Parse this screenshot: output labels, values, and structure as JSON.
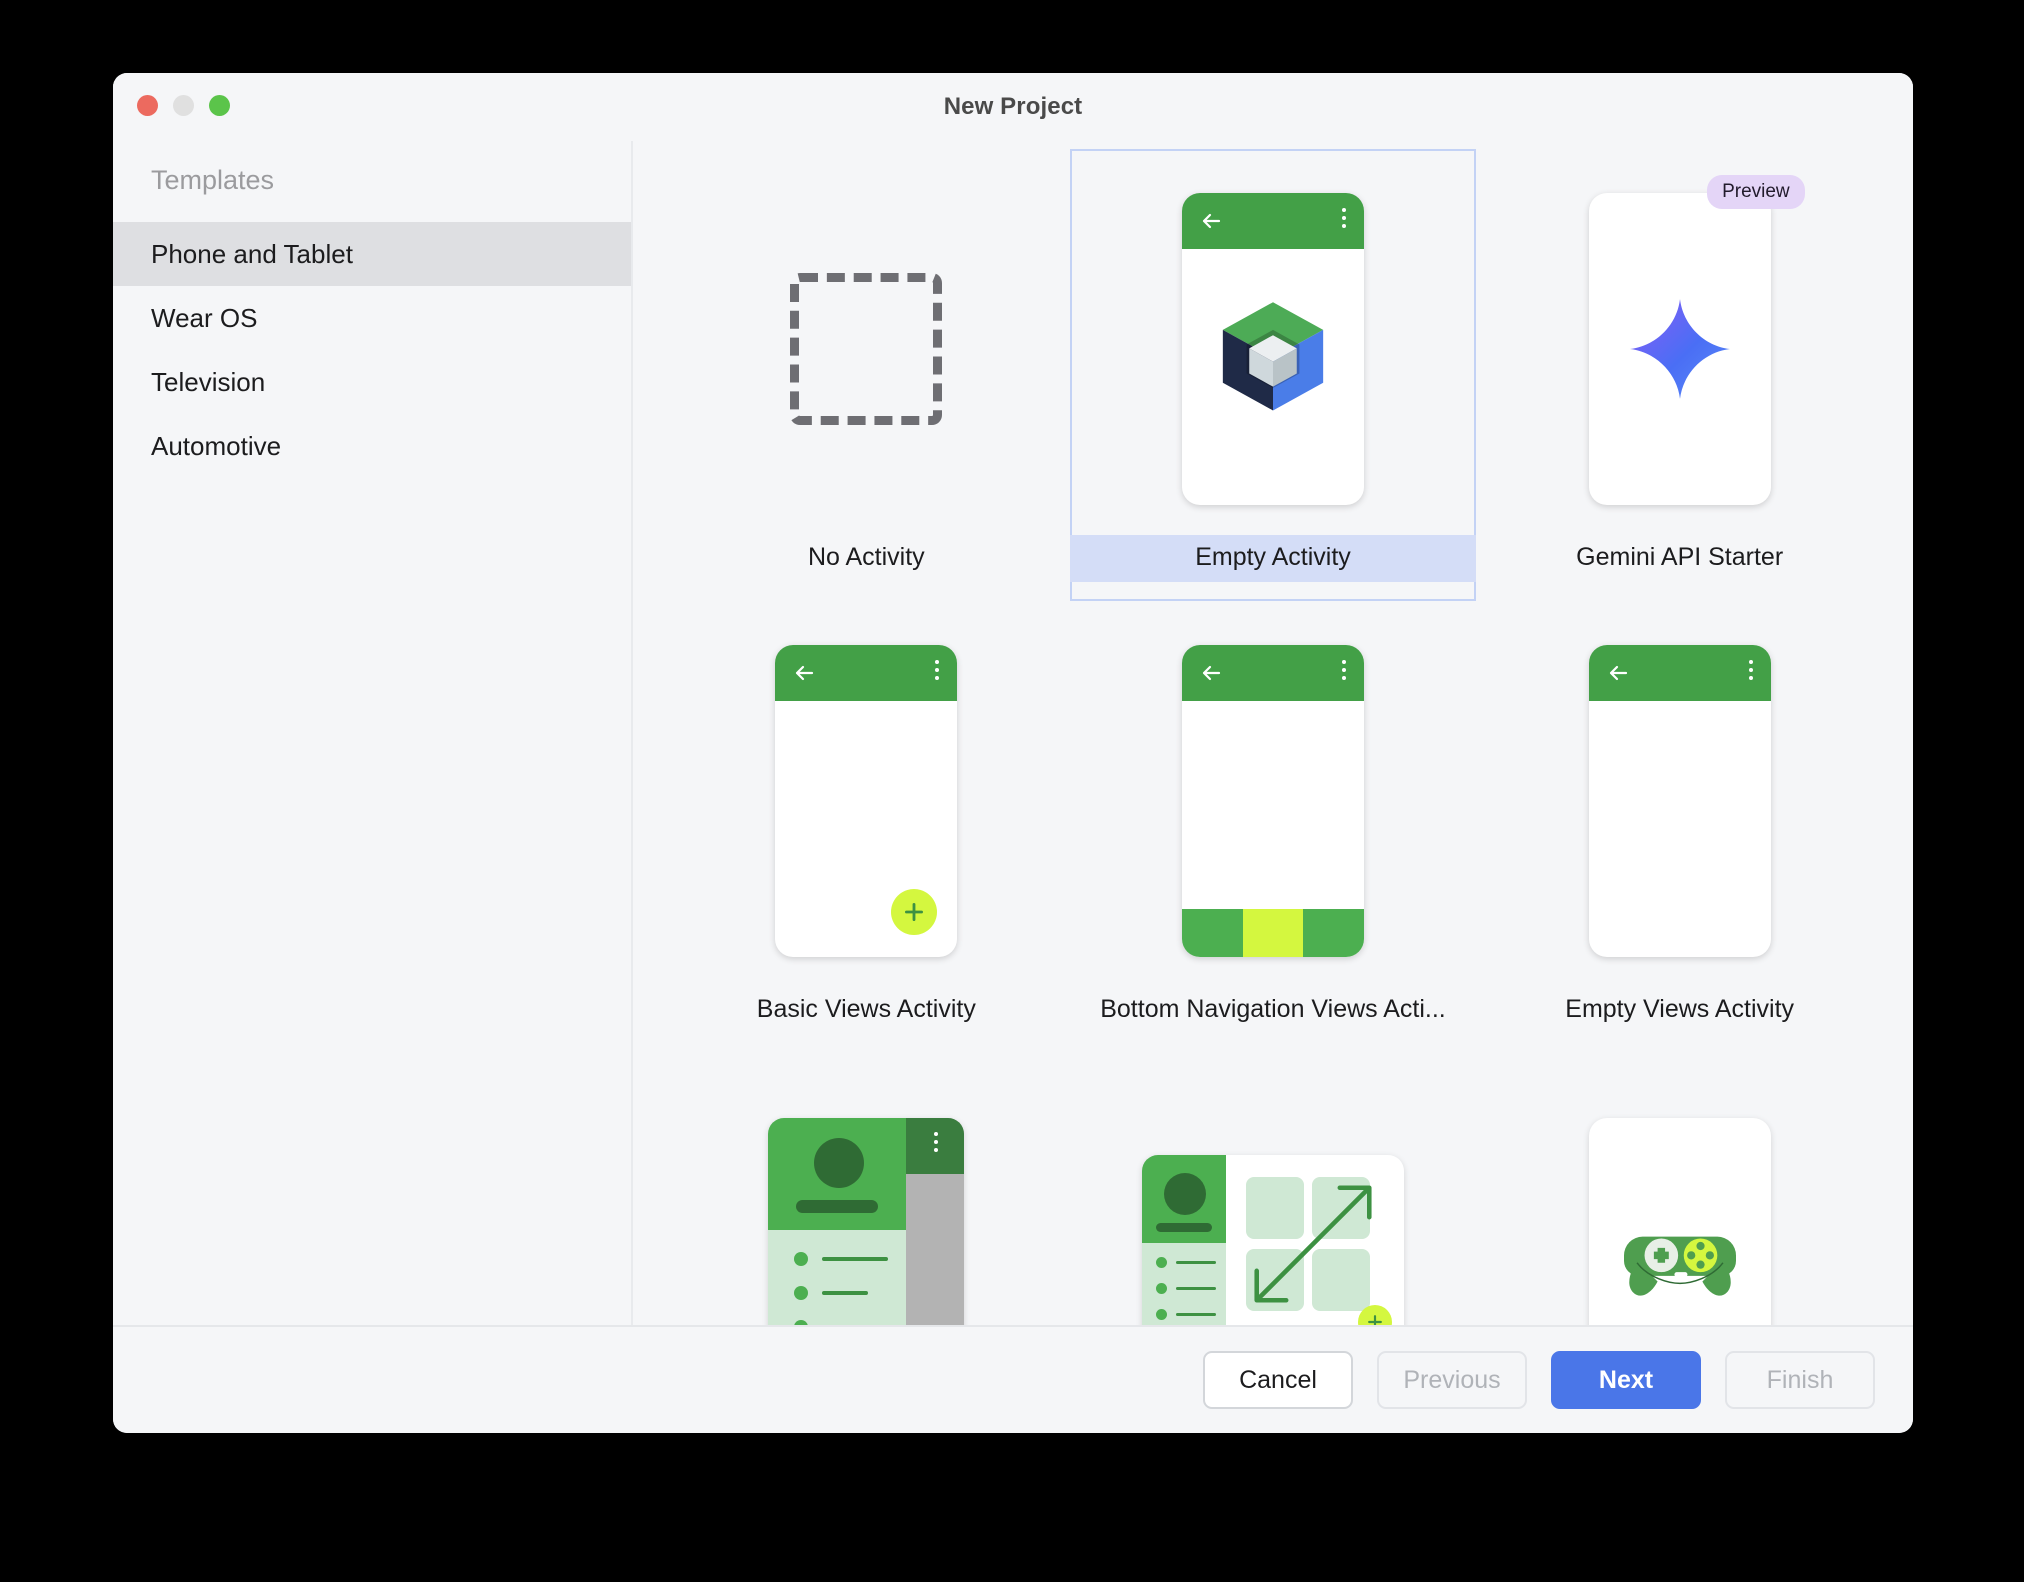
{
  "window": {
    "title": "New Project",
    "traffic_lights": [
      "close-button",
      "minimize-button",
      "maximize-button"
    ]
  },
  "sidebar": {
    "heading": "Templates",
    "items": [
      {
        "label": "Phone and Tablet",
        "selected": true
      },
      {
        "label": "Wear OS",
        "selected": false
      },
      {
        "label": "Television",
        "selected": false
      },
      {
        "label": "Automotive",
        "selected": false
      }
    ]
  },
  "templates": [
    {
      "label": "No Activity",
      "selected": false,
      "badge": null
    },
    {
      "label": "Empty Activity",
      "selected": true,
      "badge": null
    },
    {
      "label": "Gemini API Starter",
      "selected": false,
      "badge": "Preview"
    },
    {
      "label": "Basic Views Activity",
      "selected": false,
      "badge": null
    },
    {
      "label": "Bottom Navigation Views Acti...",
      "selected": false,
      "badge": null
    },
    {
      "label": "Empty Views Activity",
      "selected": false,
      "badge": null
    },
    {
      "label": "",
      "selected": false,
      "badge": null
    },
    {
      "label": "",
      "selected": false,
      "badge": null
    },
    {
      "label": "",
      "selected": false,
      "badge": null
    }
  ],
  "footer": {
    "cancel": "Cancel",
    "previous": "Previous",
    "next": "Next",
    "finish": "Finish"
  },
  "colors": {
    "accent_blue": "#4a76e8",
    "selection_band": "#d4ddf7",
    "selection_border": "#c3d2f5",
    "android_green": "#4caf50",
    "appbar_green": "#43a047",
    "lime": "#d4f73f",
    "badge_purple": "#e4d5f7",
    "window_bg": "#f5f6f8",
    "sidebar_selected": "#dedfe2"
  }
}
